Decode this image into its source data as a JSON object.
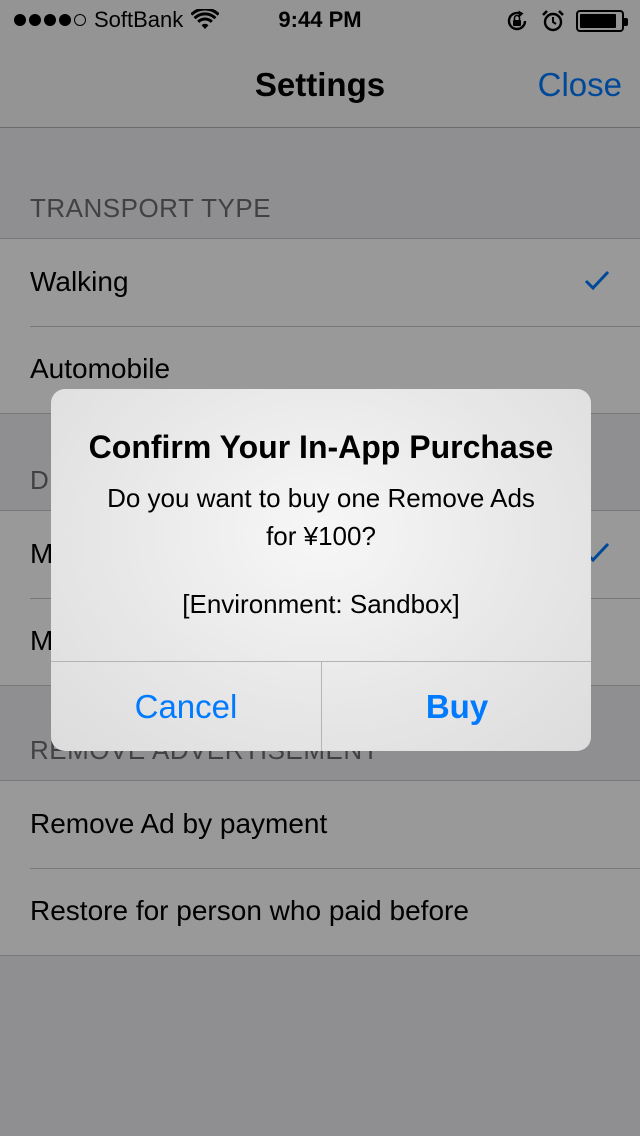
{
  "status_bar": {
    "carrier": "SoftBank",
    "time": "9:44 PM",
    "signal_bars": 4,
    "signal_max": 5,
    "battery_level": 0.9
  },
  "nav": {
    "title": "Settings",
    "close_label": "Close"
  },
  "sections": [
    {
      "header": "TRANSPORT TYPE",
      "rows": [
        {
          "label": "Walking",
          "checked": true
        },
        {
          "label": "Automobile",
          "checked": false
        }
      ]
    },
    {
      "header": "D",
      "rows": [
        {
          "label": "M",
          "checked": true
        },
        {
          "label": "M",
          "checked": false
        }
      ]
    },
    {
      "header": "REMOVE ADVERTISEMENT",
      "rows": [
        {
          "label": "Remove Ad by payment",
          "checked": false
        },
        {
          "label": "Restore for person who paid before",
          "checked": false
        }
      ]
    }
  ],
  "alert": {
    "title": "Confirm Your In-App Purchase",
    "message_line1": "Do you want to buy one Remove Ads",
    "message_line2": "for ¥100?",
    "environment": "[Environment: Sandbox]",
    "cancel_label": "Cancel",
    "buy_label": "Buy"
  },
  "colors": {
    "accent": "#007aff",
    "background": "#efeff4",
    "section_header_text": "#6d6d72"
  },
  "icons": {
    "wifi": "wifi-icon",
    "rotation_lock": "rotation-lock-icon",
    "alarm": "alarm-icon",
    "battery": "battery-icon",
    "checkmark": "checkmark-icon"
  }
}
